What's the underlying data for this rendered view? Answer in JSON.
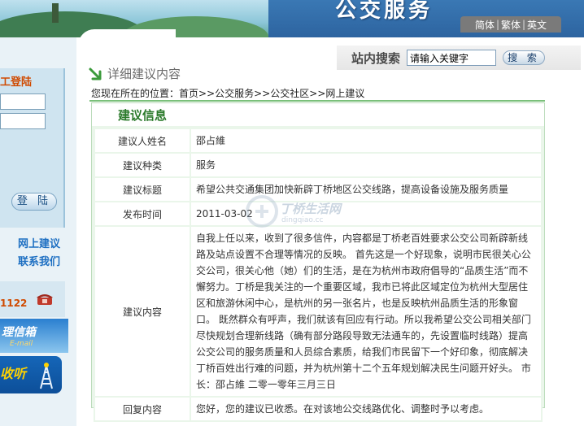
{
  "header": {
    "site_title": "公交服务",
    "lang": {
      "simplified": "简体",
      "traditional": "繁体",
      "english": "英文",
      "sep": "|"
    }
  },
  "sidebar": {
    "login_title": "工登陆",
    "login_button": "登 陆",
    "links": [
      "网上建议",
      "联系我们"
    ],
    "hotline": "1122",
    "mailbox": "理信箱",
    "mailbox_sub": "E-mail",
    "radio": "收听"
  },
  "search": {
    "label": "站内搜索",
    "placeholder": "请输入关键字",
    "value": "请输入关键字",
    "button": "搜 索"
  },
  "page": {
    "title": "详细建议内容",
    "breadcrumb": {
      "prefix": "您现在所在的位置：",
      "items": [
        "首页",
        "公交服务",
        "公交社区",
        "网上建议"
      ],
      "sep": ">>"
    }
  },
  "panel": {
    "title": "建议信息",
    "rows": [
      {
        "label": "建议人姓名",
        "value": "邵占維"
      },
      {
        "label": "建议种类",
        "value": "服务"
      },
      {
        "label": "建议标题",
        "value": "希望公共交通集团加快新辟丁桥地区公交线路，提高设备设施及服务质量"
      },
      {
        "label": "发布时间",
        "value": "2011-03-02"
      },
      {
        "label": "建议内容",
        "value": "自我上任以来，收到了很多信件，内容都是丁桥老百姓要求公交公司新辟新线路及站点设置不合理等情况的反映。 首先这是一个好现象，说明市民很关心公交公司，很关心他（她）们的生活，是在为杭州市政府倡导的“品质生活”而不懈努力。丁桥是我关注的一个重要区域，我市已将此区域定位为杭州大型居住区和旅游休闲中心，是杭州的另一张名片，也是反映杭州品质生活的形象窗口。 既然群众有呼声，我们就该有回应有行动。所以我希望公交公司相关部门尽快规划合理新线路（确有部分路段导致无法通车的，先设置临时线路）提高公交公司的服务质量和人员综合素质，给我们市民留下一个好印象，彻底解决丁桥百姓出行难的问题，并为杭州第十二个五年规划解决民生问题开好头。 市长：邵占維 二零一零年三月三日"
      },
      {
        "label": "回复内容",
        "value": "您好，您的建议已收悉。在对该地公交线路优化、调整时予以考虑。"
      }
    ]
  },
  "watermark": {
    "text": "丁桥生活网",
    "url": "dingqiao.cc"
  },
  "colors": {
    "accent_green": "#2b7a2b",
    "panel_bg": "#eaf6ea",
    "header_blue": "#2d64a0",
    "link_blue": "#1d6fc2",
    "orange": "#d04a00"
  },
  "icons": [
    "arrow-down-right-icon",
    "phone-icon",
    "radio-tower-icon"
  ]
}
